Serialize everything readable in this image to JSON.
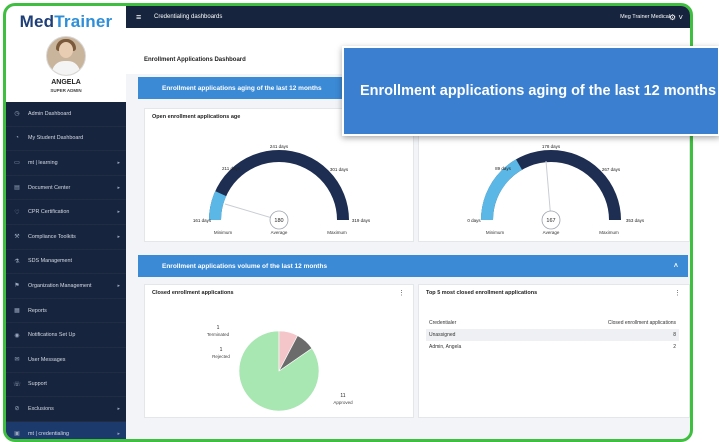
{
  "sidebar": {
    "logo_main": "Med",
    "logo_accent": "Trainer",
    "user_name": "ANGELA",
    "user_role": "SUPER ADMIN",
    "items": [
      {
        "label": "Admin Dashboard",
        "icon": "dashboard-icon",
        "chevron": false
      },
      {
        "label": "My Student Dashboard",
        "icon": "student-icon",
        "chevron": false
      },
      {
        "label": "mt | learning",
        "icon": "laptop-icon",
        "chevron": true
      },
      {
        "label": "Document Center",
        "icon": "document-icon",
        "chevron": true
      },
      {
        "label": "CPR Certification",
        "icon": "heart-icon",
        "chevron": true
      },
      {
        "label": "Compliance Toolkits",
        "icon": "wrench-icon",
        "chevron": true
      },
      {
        "label": "SDS Management",
        "icon": "flask-icon",
        "chevron": false
      },
      {
        "label": "Organization Management",
        "icon": "org-icon",
        "chevron": true
      },
      {
        "label": "Reports",
        "icon": "reports-icon",
        "chevron": false
      },
      {
        "label": "Notifications Set Up",
        "icon": "bell-icon",
        "chevron": false
      },
      {
        "label": "User Messages",
        "icon": "message-icon",
        "chevron": false
      },
      {
        "label": "Support",
        "icon": "support-icon",
        "chevron": false
      },
      {
        "label": "Exclusions",
        "icon": "exclusions-icon",
        "chevron": true
      },
      {
        "label": "mt | credentialing",
        "icon": "credential-icon",
        "chevron": true
      }
    ]
  },
  "topbar": {
    "menu_icon": "≡",
    "title": "Credentialing dashboards",
    "org": "Meg Trainer Medical",
    "gear_icon": "⚙ ˅"
  },
  "page": {
    "title": "Enrollment Applications Dashboard",
    "tab_hint": "Dashboard"
  },
  "band1": {
    "label": "Enrollment applications aging of the last 12 months"
  },
  "band2": {
    "label": "Enrollment applications volume of the last 12 months",
    "toggle": "˄"
  },
  "gauge_left": {
    "title": "Open enrollment applications age",
    "min": "161 days",
    "q1": "211 days",
    "mid": "241 days",
    "q3": "301 days",
    "max": "319 days",
    "value": "180",
    "lbl_min": "Minimum",
    "lbl_avg": "Average",
    "lbl_max": "Maximum",
    "value_fraction": 0.12
  },
  "gauge_right": {
    "min": "0 days",
    "q1": "89 days",
    "mid": "178 days",
    "q3": "267 days",
    "max": "353 days",
    "value": "167",
    "lbl_min": "Minimum",
    "lbl_avg": "Average",
    "lbl_max": "Maximum",
    "value_fraction": 0.47
  },
  "pie": {
    "title": "Closed enrollment applications",
    "kebab": "⋮",
    "terminated_count": "1",
    "terminated_label": "Terminated",
    "rejected_count": "1",
    "rejected_label": "Rejected",
    "approved_count": "11",
    "approved_label": "Approved"
  },
  "chart_data": {
    "type": "pie",
    "categories": [
      "Approved",
      "Rejected",
      "Terminated"
    ],
    "values": [
      11,
      1,
      1
    ],
    "colors": [
      "#a8e6b2",
      "#f4c6c9",
      "#6b6b6b"
    ]
  },
  "top5": {
    "title": "Top 5 most closed enrollment applications",
    "kebab": "⋮",
    "col1": "Credentialer",
    "col2": "Closed enrollment applications",
    "rows": [
      {
        "name": "Unassigned",
        "count": "8"
      },
      {
        "name": "Admin, Angela",
        "count": "2"
      }
    ]
  },
  "callout": {
    "text": "Enrollment applications aging of the last 12 months"
  },
  "colors": {
    "band": "#3b8ad6",
    "sidebar": "#16243d",
    "gauge_dark": "#1d2e52",
    "gauge_light": "#5bb8e6",
    "frame": "#3fbf3f"
  }
}
